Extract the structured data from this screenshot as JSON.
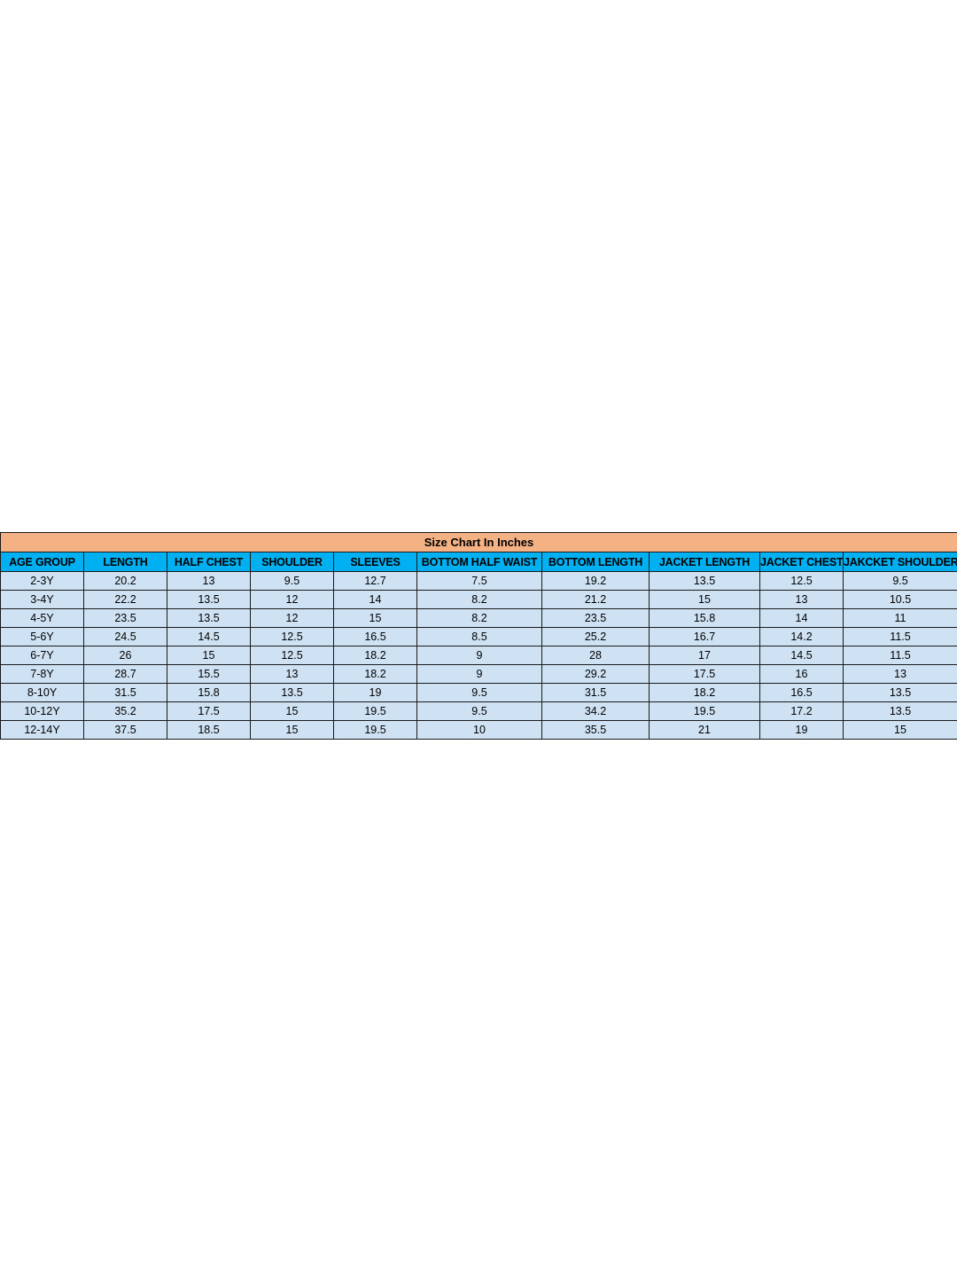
{
  "title": "Size Chart In Inches",
  "colors": {
    "title_bg": "#f4b183",
    "header_bg": "#00b0f0",
    "row_bg": "#cfe2f3",
    "border": "#1a1a1a"
  },
  "headers": [
    "AGE GROUP",
    "LENGTH",
    "HALF CHEST",
    "SHOULDER",
    "SLEEVES",
    "BOTTOM HALF WAIST",
    "BOTTOM LENGTH",
    "JACKET LENGTH",
    "JACKET CHEST",
    "JAKCKET SHOULDER"
  ],
  "rows": [
    [
      "2-3Y",
      "20.2",
      "13",
      "9.5",
      "12.7",
      "7.5",
      "19.2",
      "13.5",
      "12.5",
      "9.5"
    ],
    [
      "3-4Y",
      "22.2",
      "13.5",
      "12",
      "14",
      "8.2",
      "21.2",
      "15",
      "13",
      "10.5"
    ],
    [
      "4-5Y",
      "23.5",
      "13.5",
      "12",
      "15",
      "8.2",
      "23.5",
      "15.8",
      "14",
      "11"
    ],
    [
      "5-6Y",
      "24.5",
      "14.5",
      "12.5",
      "16.5",
      "8.5",
      "25.2",
      "16.7",
      "14.2",
      "11.5"
    ],
    [
      "6-7Y",
      "26",
      "15",
      "12.5",
      "18.2",
      "9",
      "28",
      "17",
      "14.5",
      "11.5"
    ],
    [
      "7-8Y",
      "28.7",
      "15.5",
      "13",
      "18.2",
      "9",
      "29.2",
      "17.5",
      "16",
      "13"
    ],
    [
      "8-10Y",
      "31.5",
      "15.8",
      "13.5",
      "19",
      "9.5",
      "31.5",
      "18.2",
      "16.5",
      "13.5"
    ],
    [
      "10-12Y",
      "35.2",
      "17.5",
      "15",
      "19.5",
      "9.5",
      "34.2",
      "19.5",
      "17.2",
      "13.5"
    ],
    [
      "12-14Y",
      "37.5",
      "18.5",
      "15",
      "19.5",
      "10",
      "35.5",
      "21",
      "19",
      "15"
    ]
  ]
}
